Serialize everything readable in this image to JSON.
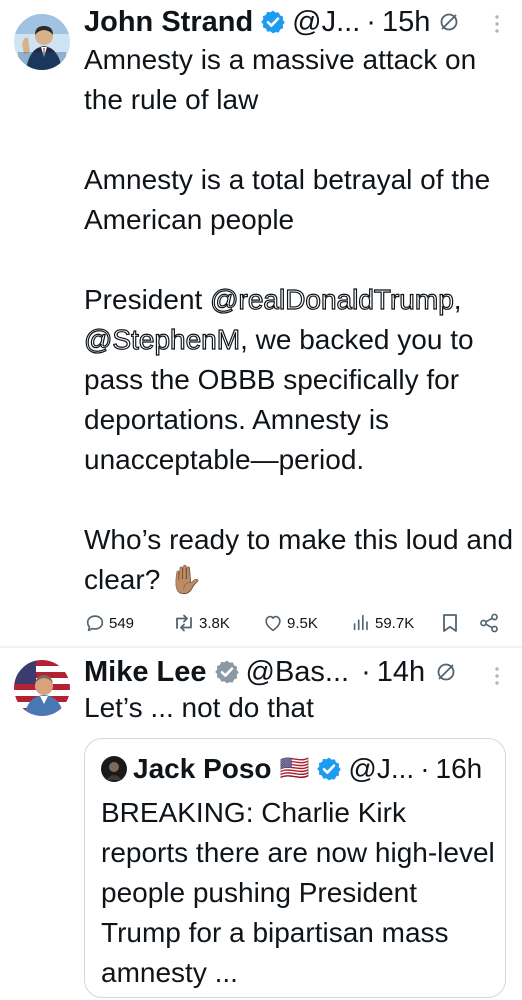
{
  "tweet1": {
    "author_name": "John Strand",
    "handle": "@J...",
    "separator": "·",
    "time": "15h",
    "body_para1": "Amnesty is a massive attack on the rule of law",
    "body_para2": "Amnesty is a total betrayal of the American people",
    "body_para3_prefix": "President ",
    "mention1": "@realDonaldTrump",
    "comma": ",",
    "mention2": "@StephenM",
    "body_para3_rest": ", we backed you to pass the OBBB specifically for deportations. Amnesty is unacceptable—period.",
    "body_para4": "Who’s ready to make this loud and clear? ✋🏽",
    "actions": {
      "replies": "549",
      "reposts": "3.8K",
      "likes": "9.5K",
      "views": "59.7K"
    }
  },
  "tweet2": {
    "author_name": "Mike Lee",
    "handle": "@Bas...",
    "separator": "·",
    "time": "14h",
    "body": "Let’s ... not do that",
    "quote": {
      "author_name": "Jack Poso",
      "flag": "🇺🇸",
      "handle": "@J...",
      "separator": "·",
      "time": "16h",
      "body": "BREAKING: Charlie Kirk reports there are now high-level people pushing President Trump for a bipartisan mass amnesty ..."
    }
  },
  "colors": {
    "verified_blue": "#1d9bf0",
    "text": "#0f1419",
    "muted": "#536471",
    "border": "#cfd9de"
  }
}
